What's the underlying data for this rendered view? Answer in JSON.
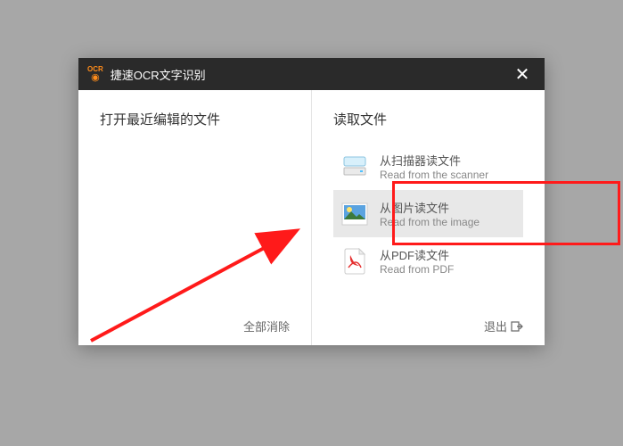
{
  "titlebar": {
    "logo_top": "OCR",
    "title": "捷速OCR文字识别"
  },
  "left": {
    "heading": "打开最近编辑的文件",
    "clear_all": "全部消除"
  },
  "right": {
    "heading": "读取文件",
    "items": [
      {
        "cn": "从扫描器读文件",
        "en": "Read from the scanner"
      },
      {
        "cn": "从图片读文件",
        "en": "Read from the image"
      },
      {
        "cn": "从PDF读文件",
        "en": "Read from PDF"
      }
    ],
    "exit": "退出"
  }
}
